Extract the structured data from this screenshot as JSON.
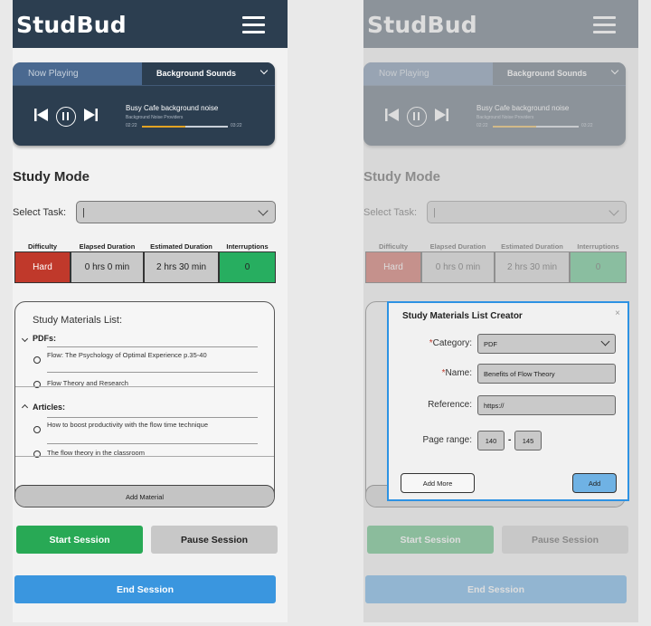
{
  "app": {
    "name": "StudBud"
  },
  "player": {
    "tab_now_playing": "Now Playing",
    "tab_background_sounds": "Background Sounds",
    "track_title": "Busy Cafe background noise",
    "track_provider": "Background Noise Providers",
    "time_elapsed": "02:22",
    "time_total": "03:22",
    "progress_fraction": 0.5
  },
  "study_mode": {
    "title": "Study Mode",
    "select_task_label": "Select Task:",
    "select_task_value": "|",
    "stats": {
      "headers": [
        "Difficulty",
        "Elapsed Duration",
        "Estimated Duration",
        "Interruptions"
      ],
      "values": [
        "Hard",
        "0 hrs 0 min",
        "2 hrs 30 min",
        "0"
      ]
    }
  },
  "materials": {
    "title": "Study Materials List:",
    "groups": [
      {
        "label": "PDFs:",
        "items": [
          "Flow: The Psychology of Optimal Experience p.35-40",
          "Flow Theory and Research"
        ]
      },
      {
        "label": "Articles:",
        "items": [
          "How to boost productivity with the flow time technique",
          "The flow theory in the classroom"
        ]
      }
    ],
    "add_button": "Add Material"
  },
  "buttons": {
    "start": "Start Session",
    "pause": "Pause Session",
    "end": "End Session"
  },
  "modal": {
    "title": "Study Materials List Creator",
    "close": "×",
    "category_label": "Category:",
    "category_value": "PDF",
    "name_label": "Name:",
    "name_value": "Benefits of Flow Theory",
    "reference_label": "Reference:",
    "reference_value": "https://",
    "page_range_label": "Page range:",
    "page_from": "140",
    "page_dash": "-",
    "page_to": "145",
    "required_mark": "*",
    "add_more": "Add More",
    "add": "Add"
  },
  "colors": {
    "header": "#2c3e50",
    "difficulty_hard": "#c0392b",
    "interruptions": "#27ae60",
    "start": "#28a955",
    "end": "#3a96df",
    "modal_border": "#2d92e3"
  }
}
